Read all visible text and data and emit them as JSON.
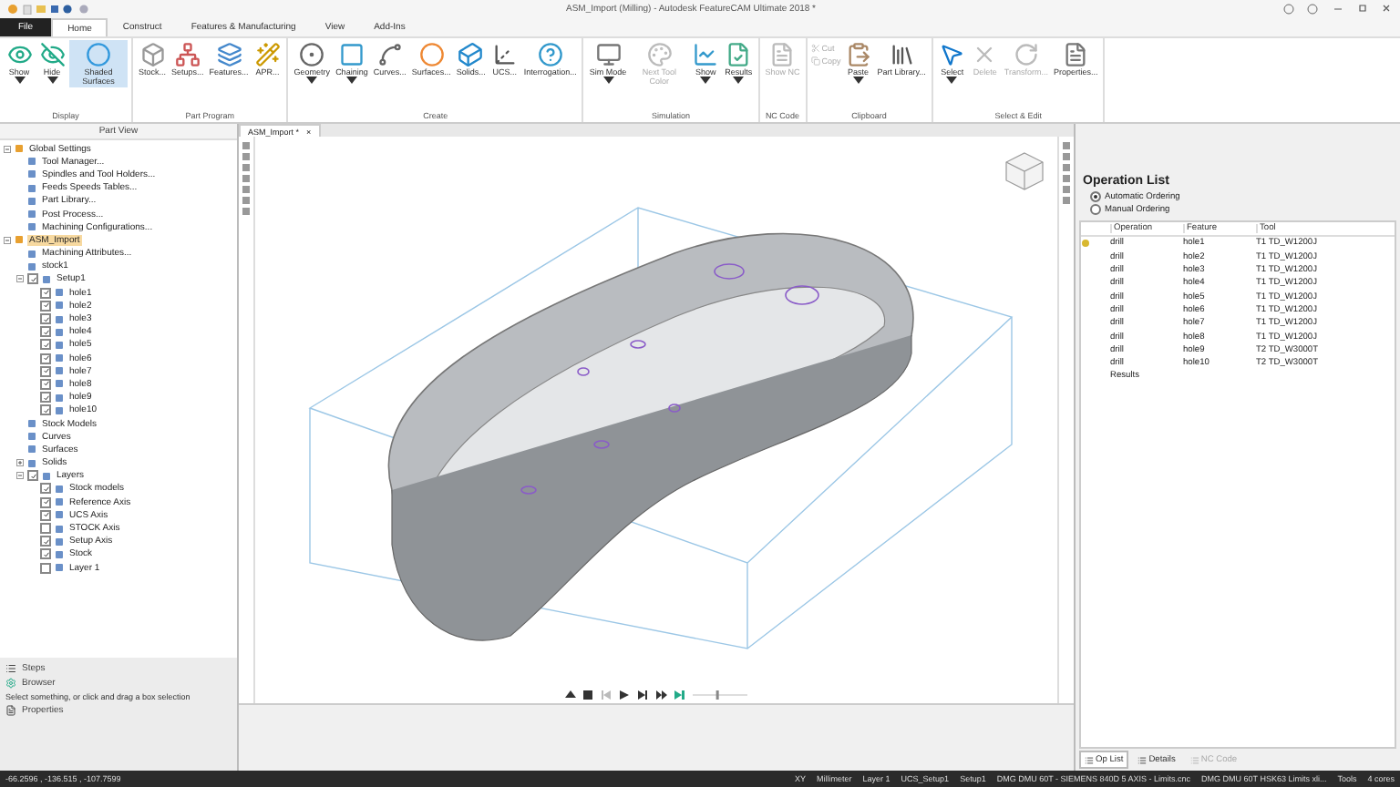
{
  "window": {
    "title": "ASM_Import (Milling) - Autodesk FeatureCAM Ultimate 2018 *"
  },
  "tabs": [
    {
      "label": "File",
      "kind": "file",
      "selected": false
    },
    {
      "label": "Home",
      "kind": "tab",
      "selected": true
    },
    {
      "label": "Construct",
      "kind": "tab",
      "selected": false
    },
    {
      "label": "Features & Manufacturing",
      "kind": "tab",
      "selected": false
    },
    {
      "label": "View",
      "kind": "tab",
      "selected": false
    },
    {
      "label": "Add-Ins",
      "kind": "tab",
      "selected": false
    }
  ],
  "ribbon": [
    {
      "label": "Display",
      "buttons": [
        {
          "label": "Show",
          "kind": "large",
          "selected": false,
          "disabled": false,
          "dropdown": true
        },
        {
          "label": "Hide",
          "kind": "large",
          "selected": false,
          "disabled": false,
          "dropdown": true
        },
        {
          "label": "Shaded Surfaces",
          "kind": "large",
          "selected": true,
          "disabled": false,
          "dropdown": false
        }
      ]
    },
    {
      "label": "Part Program",
      "buttons": [
        {
          "label": "Stock...",
          "kind": "large",
          "selected": false,
          "disabled": false,
          "dropdown": false
        },
        {
          "label": "Setups...",
          "kind": "large",
          "selected": false,
          "disabled": false,
          "dropdown": false
        },
        {
          "label": "Features...",
          "kind": "large",
          "selected": false,
          "disabled": false,
          "dropdown": false
        },
        {
          "label": "APR...",
          "kind": "large",
          "selected": false,
          "disabled": false,
          "dropdown": false
        }
      ]
    },
    {
      "label": "Create",
      "buttons": [
        {
          "label": "Geometry",
          "kind": "large",
          "selected": false,
          "disabled": false,
          "dropdown": true
        },
        {
          "label": "Chaining",
          "kind": "large",
          "selected": false,
          "disabled": false,
          "dropdown": true
        },
        {
          "label": "Curves...",
          "kind": "large",
          "selected": false,
          "disabled": false,
          "dropdown": false
        },
        {
          "label": "Surfaces...",
          "kind": "large",
          "selected": false,
          "disabled": false,
          "dropdown": false
        },
        {
          "label": "Solids...",
          "kind": "large",
          "selected": false,
          "disabled": false,
          "dropdown": false
        },
        {
          "label": "UCS...",
          "kind": "large",
          "selected": false,
          "disabled": false,
          "dropdown": false
        },
        {
          "label": "Interrogation...",
          "kind": "large",
          "selected": false,
          "disabled": false,
          "dropdown": false
        }
      ]
    },
    {
      "label": "Simulation",
      "buttons": [
        {
          "label": "Sim Mode",
          "kind": "large",
          "selected": false,
          "disabled": false,
          "dropdown": true
        },
        {
          "label": "Next Tool Color",
          "kind": "large",
          "selected": false,
          "disabled": true,
          "dropdown": false
        },
        {
          "label": "Show",
          "kind": "large",
          "selected": false,
          "disabled": false,
          "dropdown": true
        },
        {
          "label": "Results",
          "kind": "large",
          "selected": false,
          "disabled": false,
          "dropdown": true
        }
      ]
    },
    {
      "label": "NC Code",
      "buttons": [
        {
          "label": "Show NC",
          "kind": "large",
          "selected": false,
          "disabled": true,
          "dropdown": false
        }
      ]
    },
    {
      "label": "Clipboard",
      "buttons": [
        {
          "label": "Cut",
          "kind": "small",
          "selected": false,
          "disabled": true
        },
        {
          "label": "Copy",
          "kind": "small",
          "selected": false,
          "disabled": true
        },
        {
          "label": "Paste",
          "kind": "large",
          "selected": false,
          "disabled": false,
          "dropdown": true
        },
        {
          "label": "Part Library...",
          "kind": "large",
          "selected": false,
          "disabled": false,
          "dropdown": false
        }
      ]
    },
    {
      "label": "Select & Edit",
      "buttons": [
        {
          "label": "Select",
          "kind": "large",
          "selected": false,
          "disabled": false,
          "dropdown": true
        },
        {
          "label": "Delete",
          "kind": "large",
          "selected": false,
          "disabled": true,
          "dropdown": false
        },
        {
          "label": "Transform...",
          "kind": "large",
          "selected": false,
          "disabled": true,
          "dropdown": false
        },
        {
          "label": "Properties...",
          "kind": "large",
          "selected": false,
          "disabled": false,
          "dropdown": false
        }
      ]
    }
  ],
  "part_view": {
    "title": "Part View",
    "tree": [
      {
        "label": "Global Settings",
        "selected": false,
        "expanded": true,
        "children": [
          {
            "label": "Tool Manager...",
            "selected": false
          },
          {
            "label": "Spindles and Tool Holders...",
            "selected": false
          },
          {
            "label": "Feeds Speeds Tables...",
            "selected": false
          },
          {
            "label": "Part Library...",
            "selected": false
          },
          {
            "label": "Post Process...",
            "selected": false
          },
          {
            "label": "Machining Configurations...",
            "selected": false
          }
        ]
      },
      {
        "label": "ASM_Import",
        "selected": true,
        "expanded": true,
        "children": [
          {
            "label": "Machining Attributes...",
            "selected": false
          },
          {
            "label": "stock1",
            "selected": false
          },
          {
            "label": "Setup1",
            "selected": false,
            "checked": true,
            "expanded": true,
            "children": [
              {
                "label": "hole1",
                "selected": false,
                "checked": true
              },
              {
                "label": "hole2",
                "selected": false,
                "checked": true
              },
              {
                "label": "hole3",
                "selected": false,
                "checked": true
              },
              {
                "label": "hole4",
                "selected": false,
                "checked": true
              },
              {
                "label": "hole5",
                "selected": false,
                "checked": true
              },
              {
                "label": "hole6",
                "selected": false,
                "checked": true
              },
              {
                "label": "hole7",
                "selected": false,
                "checked": true
              },
              {
                "label": "hole8",
                "selected": false,
                "checked": true
              },
              {
                "label": "hole9",
                "selected": false,
                "checked": true
              },
              {
                "label": "hole10",
                "selected": false,
                "checked": true
              }
            ]
          },
          {
            "label": "Stock Models",
            "selected": false
          },
          {
            "label": "Curves",
            "selected": false
          },
          {
            "label": "Surfaces",
            "selected": false
          },
          {
            "label": "Solids",
            "selected": false,
            "expanded": false
          },
          {
            "label": "Layers",
            "selected": false,
            "checked": true,
            "expanded": true,
            "children": [
              {
                "label": "Stock models",
                "selected": false,
                "checked": true
              },
              {
                "label": "Reference Axis",
                "selected": false,
                "checked": true
              },
              {
                "label": "UCS Axis",
                "selected": false,
                "checked": true
              },
              {
                "label": "STOCK Axis",
                "selected": false,
                "checked": false
              },
              {
                "label": "Setup Axis",
                "selected": false,
                "checked": true
              },
              {
                "label": "Stock",
                "selected": false,
                "checked": true
              },
              {
                "label": "Layer 1",
                "selected": false,
                "checked": false
              }
            ]
          }
        ]
      }
    ],
    "bottom_tabs": [
      {
        "label": "Steps",
        "selected": false
      },
      {
        "label": "Browser",
        "selected": false
      }
    ],
    "hint": "Select something, or click and drag a box selection",
    "properties": "Properties"
  },
  "document_tab": {
    "label": "ASM_Import *",
    "close": "×"
  },
  "playback_speed": {
    "level": 0.45
  },
  "operation_list": {
    "title": "Operation List",
    "ordering": [
      {
        "label": "Automatic Ordering",
        "selected": true
      },
      {
        "label": "Manual Ordering",
        "selected": false
      }
    ],
    "columns": [
      "Operation",
      "Feature",
      "Tool"
    ],
    "rows": [
      {
        "operation": "drill",
        "feature": "hole1",
        "tool": "T1 TD_W1200J",
        "current": true
      },
      {
        "operation": "drill",
        "feature": "hole2",
        "tool": "T1 TD_W1200J",
        "current": false
      },
      {
        "operation": "drill",
        "feature": "hole3",
        "tool": "T1 TD_W1200J",
        "current": false
      },
      {
        "operation": "drill",
        "feature": "hole4",
        "tool": "T1 TD_W1200J",
        "current": false
      },
      {
        "operation": "drill",
        "feature": "hole5",
        "tool": "T1 TD_W1200J",
        "current": false
      },
      {
        "operation": "drill",
        "feature": "hole6",
        "tool": "T1 TD_W1200J",
        "current": false
      },
      {
        "operation": "drill",
        "feature": "hole7",
        "tool": "T1 TD_W1200J",
        "current": false
      },
      {
        "operation": "drill",
        "feature": "hole8",
        "tool": "T1 TD_W1200J",
        "current": false
      },
      {
        "operation": "drill",
        "feature": "hole9",
        "tool": "T2 TD_W3000T",
        "current": false
      },
      {
        "operation": "drill",
        "feature": "hole10",
        "tool": "T2 TD_W3000T",
        "current": false
      }
    ],
    "results": "Results",
    "tabs": [
      {
        "label": "Op List",
        "selected": true,
        "disabled": false
      },
      {
        "label": "Details",
        "selected": false,
        "disabled": false
      },
      {
        "label": "NC Code",
        "selected": false,
        "disabled": true
      }
    ]
  },
  "status_bar": {
    "coordinates": "-66.2596 , -136.515 , -107.7599",
    "items": [
      "XY",
      "Millimeter",
      "Layer 1",
      "UCS_Setup1",
      "Setup1",
      "DMG DMU 60T - SIEMENS 840D 5 AXIS - Limits.cnc",
      "DMG DMU 60T HSK63 Limits xli...",
      "Tools",
      "4 cores"
    ]
  }
}
